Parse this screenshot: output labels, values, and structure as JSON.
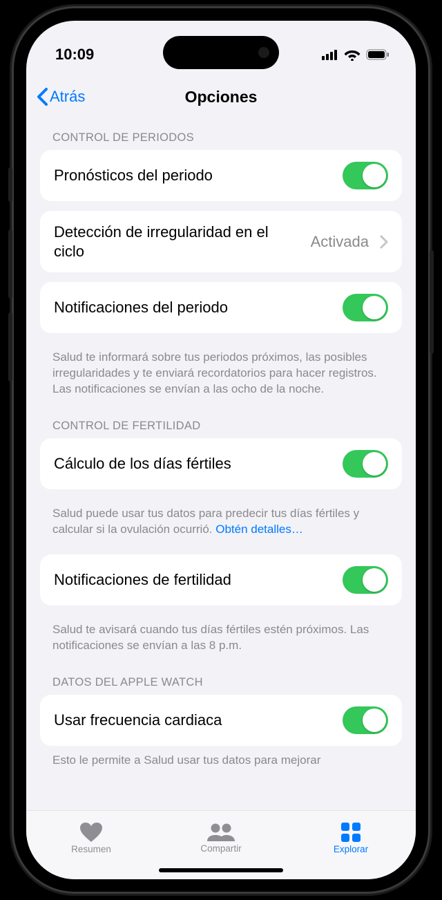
{
  "status": {
    "time": "10:09"
  },
  "nav": {
    "back": "Atrás",
    "title": "Opciones"
  },
  "sections": {
    "period": {
      "header": "CONTROL DE PERIODOS",
      "predictions": "Pronósticos del periodo",
      "deviation": "Detección de irregularidad en el ciclo",
      "deviation_value": "Activada",
      "notifications": "Notificaciones del periodo",
      "footer": "Salud te informará sobre tus periodos próximos, las posibles irregularidades y te enviará recordatorios para hacer registros. Las notificaciones se envían a las ocho de la noche."
    },
    "fertility": {
      "header": "CONTROL DE FERTILIDAD",
      "fertile_window": "Cálculo de los días fértiles",
      "fertile_footer_text": "Salud puede usar tus datos para predecir tus días fértiles y calcular si la ovulación ocurrió. ",
      "fertile_footer_link": "Obtén detalles…",
      "notifications": "Notificaciones de fertilidad",
      "notif_footer": "Salud te avisará cuando tus días fértiles estén próximos. Las notificaciones se envían a las 8 p.m."
    },
    "watch": {
      "header": "DATOS DEL APPLE WATCH",
      "heart_rate": "Usar frecuencia cardiaca",
      "footer_partial": "Esto le permite a Salud usar tus datos para mejorar"
    }
  },
  "tabs": {
    "summary": "Resumen",
    "sharing": "Compartir",
    "browse": "Explorar"
  }
}
